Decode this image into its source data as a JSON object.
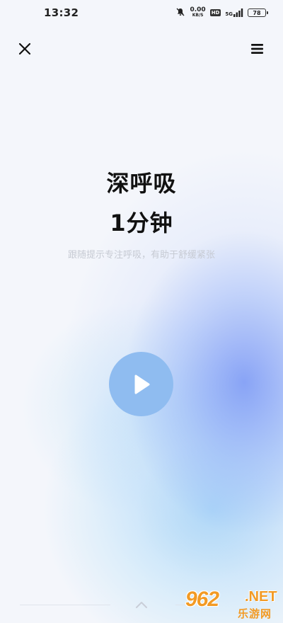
{
  "status_bar": {
    "time": "13:32",
    "net_speed_value": "0.00",
    "net_speed_unit": "KB/S",
    "hd_label": "HD",
    "network_label": "5G",
    "battery_level": "78"
  },
  "header": {
    "close_icon": "close-icon",
    "menu_icon": "menu-icon"
  },
  "main": {
    "title": "深呼吸",
    "duration": "1分钟",
    "subtitle": "跟随提示专注呼吸，有助于舒缓紧张",
    "play_icon": "play-icon"
  },
  "footer": {
    "chevron_icon": "chevron-up-icon"
  },
  "watermark": {
    "logo": "962",
    "suffix": ".NET",
    "site_name": "乐游网"
  },
  "colors": {
    "background": "#f4f6fb",
    "play_button": "#8fbcf0",
    "glow_blue": "#7896f5",
    "glow_cyan": "#8ccdf5",
    "watermark": "#f29a24"
  }
}
